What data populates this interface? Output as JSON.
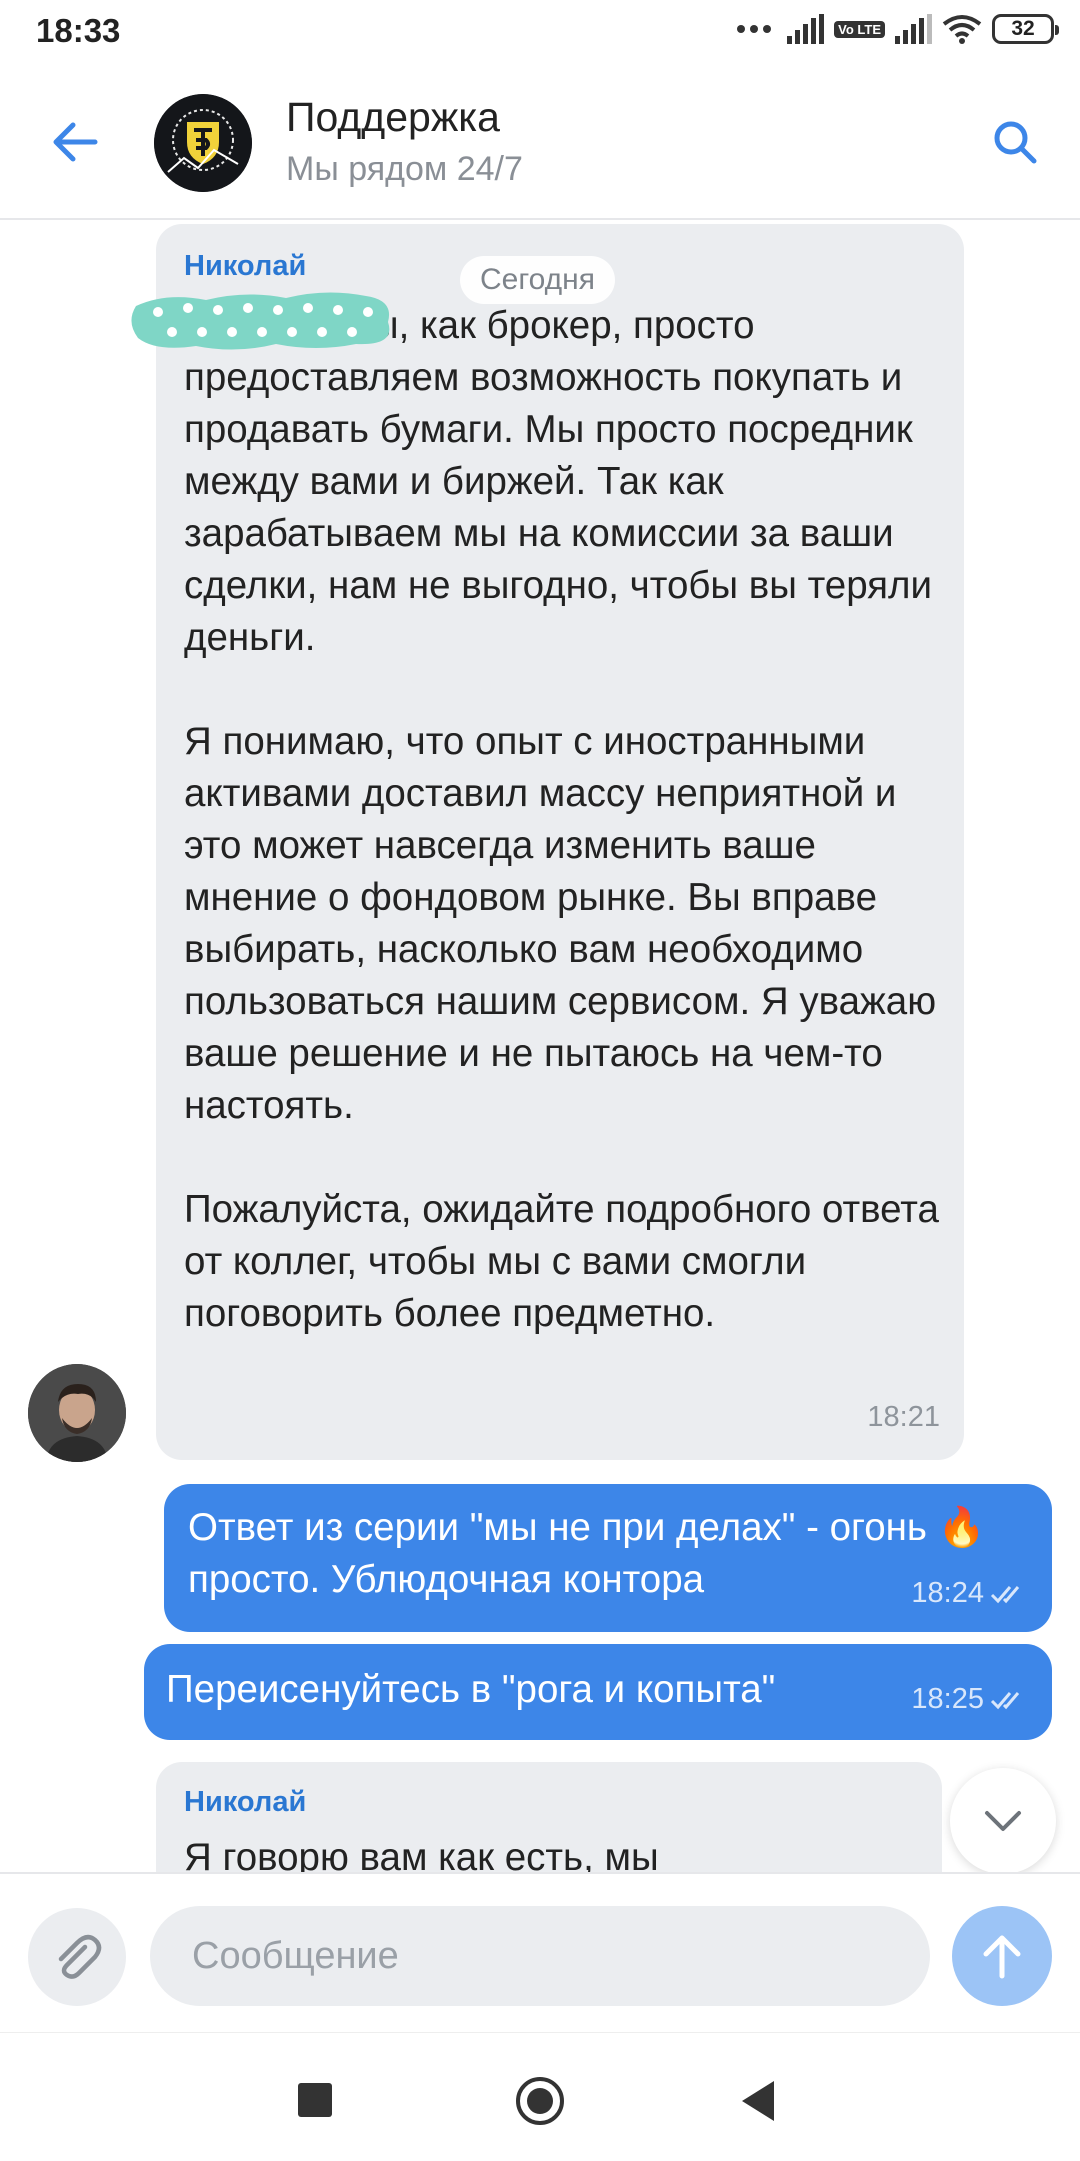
{
  "status_bar": {
    "time": "18:33",
    "battery": "32",
    "volte_label": "Vo LTE",
    "icons": [
      "dots-icon",
      "signal-icon",
      "volte-icon",
      "signal-icon",
      "wifi-icon",
      "battery-icon"
    ]
  },
  "header": {
    "title": "Поддержка",
    "subtitle": "Мы рядом 24/7",
    "back_icon": "arrow-left-icon",
    "search_icon": "search-icon",
    "accent_color": "#3d86e8"
  },
  "messages": [
    {
      "direction": "incoming",
      "sender": "Николай",
      "text": "               мы, как брокер, просто предоставляем возможность покупать и продавать бумаги. Мы просто посредник между вами и биржей. Так как зарабатываем мы на комиссии за ваши сделки, нам не выгодно, чтобы вы теряли деньги.\n\nЯ понимаю, что опыт с иностранными активами доставил массу неприятной и это может навсегда изменить ваше мнение о фондовом рынке. Вы вправе выбирать, насколько вам необходимо пользоваться нашим сервисом. Я уважаю ваше решение и не пытаюсь на чем-то настоять.\n\nПожалуйста, ожидайте подробного ответа от коллег, чтобы мы с вами смогли поговорить более предметно.",
      "time": "18:21"
    },
    {
      "direction": "outgoing",
      "text": "Ответ из серии \"мы не при делах\" - огонь 🔥просто. Ублюдочная контора",
      "time": "18:24",
      "status": "read"
    },
    {
      "direction": "outgoing",
      "text": "Переисенуйтесь в \"рога и копыта\"",
      "time": "18:25",
      "status": "read"
    },
    {
      "direction": "incoming",
      "sender": "Николай",
      "text": "Я говорю вам как есть, мы",
      "time": ""
    }
  ],
  "date_separator": "Сегодня",
  "composer": {
    "placeholder": "Сообщение",
    "attach_icon": "paperclip-icon",
    "send_icon": "arrow-up-icon"
  },
  "colors": {
    "incoming_bubble": "#ebedf0",
    "outgoing_bubble": "#3d86e8",
    "sender_name": "#2a77d2",
    "redaction": "#7fd6c6"
  }
}
